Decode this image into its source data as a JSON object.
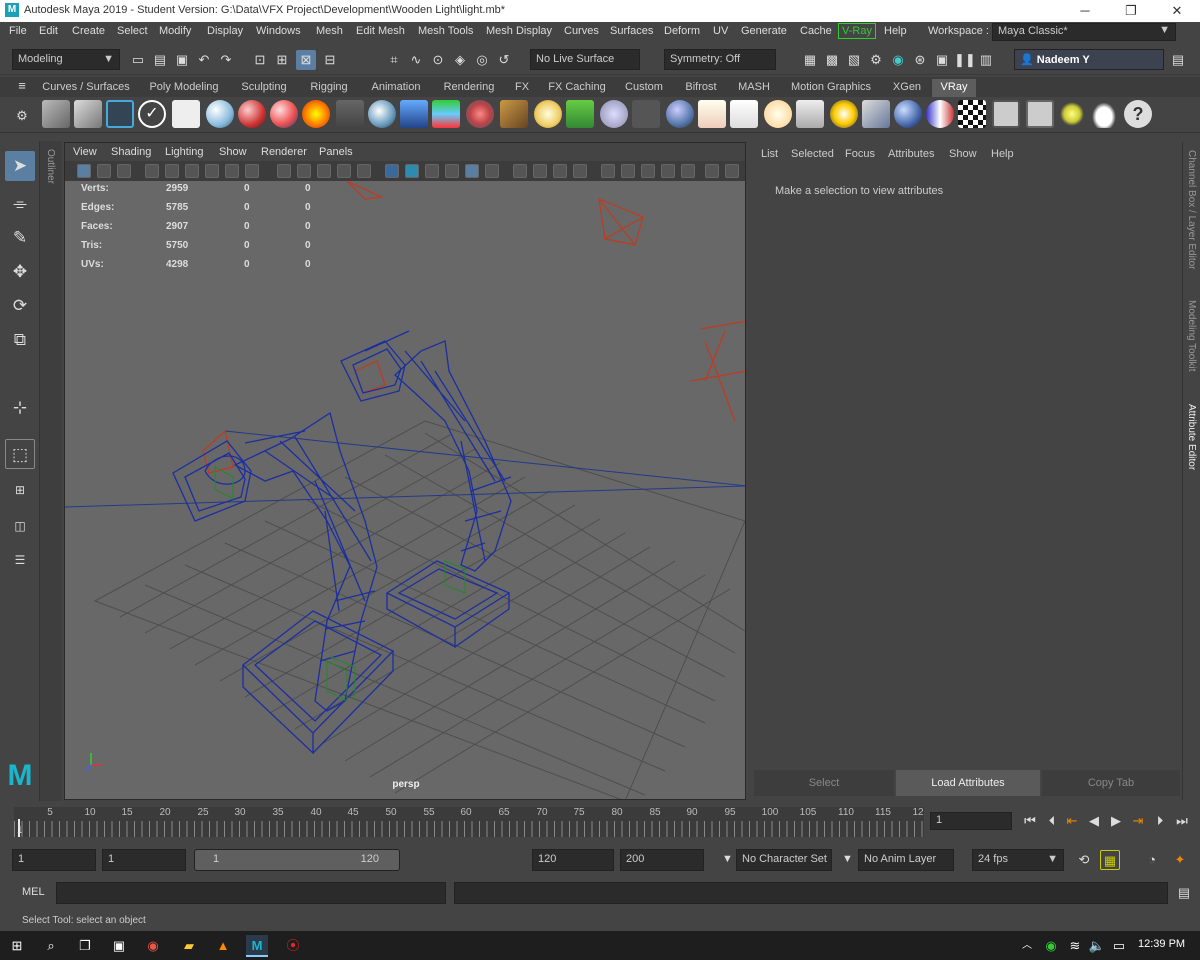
{
  "window": {
    "title": "Autodesk Maya 2019 - Student Version: G:\\Data\\VFX Project\\Development\\Wooden Light\\light.mb*",
    "app_icon": "M",
    "min": "─",
    "max": "❐",
    "close": "✕"
  },
  "menu": [
    "File",
    "Edit",
    "Create",
    "Select",
    "Modify",
    "Display",
    "Windows",
    "Mesh",
    "Edit Mesh",
    "Mesh Tools",
    "Mesh Display",
    "Curves",
    "Surfaces",
    "Deform",
    "UV",
    "Generate",
    "Cache",
    "V-Ray",
    "Help"
  ],
  "workspace": {
    "label": "Workspace :",
    "value": "Maya Classic*"
  },
  "statusline": {
    "mode": "Modeling",
    "live_surface": "No Live Surface",
    "symmetry": "Symmetry: Off",
    "user": "Nadeem Y"
  },
  "shelf_tabs": [
    "Curves / Surfaces",
    "Poly Modeling",
    "Sculpting",
    "Rigging",
    "Animation",
    "Rendering",
    "FX",
    "FX Caching",
    "Custom",
    "Bifrost",
    "MASH",
    "Motion Graphics",
    "XGen",
    "VRay"
  ],
  "active_shelf": "VRay",
  "viewport": {
    "menu": [
      "View",
      "Shading",
      "Lighting",
      "Show",
      "Renderer",
      "Panels"
    ],
    "hud": [
      {
        "label": "Verts:",
        "v1": "2959",
        "v2": "0",
        "v3": "0"
      },
      {
        "label": "Edges:",
        "v1": "5785",
        "v2": "0",
        "v3": "0"
      },
      {
        "label": "Faces:",
        "v1": "2907",
        "v2": "0",
        "v3": "0"
      },
      {
        "label": "Tris:",
        "v1": "5750",
        "v2": "0",
        "v3": "0"
      },
      {
        "label": "UVs:",
        "v1": "4298",
        "v2": "0",
        "v3": "0"
      }
    ],
    "camera": "persp"
  },
  "side_labels": {
    "outliner": "Outliner",
    "channel_box": "Channel Box / Layer Editor",
    "modeling_toolkit": "Modeling Toolkit",
    "attribute_editor": "Attribute Editor"
  },
  "attribute_editor": {
    "menu": [
      "List",
      "Selected",
      "Focus",
      "Attributes",
      "Show",
      "Help"
    ],
    "message": "Make a selection to view attributes",
    "buttons": {
      "select": "Select",
      "load": "Load Attributes",
      "copy": "Copy Tab"
    }
  },
  "timeline": {
    "ticks": [
      "5",
      "10",
      "15",
      "20",
      "25",
      "30",
      "35",
      "40",
      "45",
      "50",
      "55",
      "60",
      "65",
      "70",
      "75",
      "80",
      "85",
      "90",
      "95",
      "100",
      "105",
      "110",
      "115",
      "12"
    ],
    "current": "1",
    "start_marker": "1"
  },
  "range": {
    "start": "1",
    "anim_start": "1",
    "slider_start": "1",
    "slider_end": "120",
    "end": "120",
    "anim_end": "200",
    "character_set": "No Character Set",
    "anim_layer": "No Anim Layer",
    "fps": "24 fps"
  },
  "command": {
    "label": "MEL"
  },
  "help_line": "Select Tool: select an object",
  "taskbar": {
    "time": "12:39 PM"
  }
}
